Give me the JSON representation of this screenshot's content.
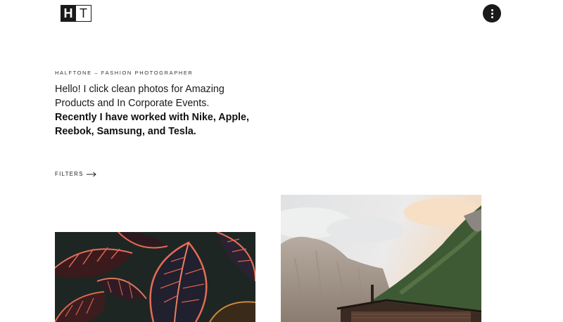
{
  "brand": {
    "logo_letter_1": "H",
    "logo_letter_2": "T"
  },
  "header": {
    "menu_icon": "more-vertical-icon"
  },
  "hero": {
    "eyebrow": "HALFTONE – FASHION PHOTOGRAPHER",
    "intro": "Hello! I click clean photos for Amazing Products and In Corporate Events.",
    "highlight": "Recently I have worked with Nike, Apple, Reebok, Samsung, and Tesla."
  },
  "filters": {
    "label": "FILTERS",
    "icon": "arrow-right-icon"
  },
  "gallery": [
    {
      "subject": "croton-leaves-photo"
    },
    {
      "subject": "mountain-cabin-photo"
    }
  ],
  "colors": {
    "text": "#1a1a1a",
    "background": "#ffffff",
    "accent": "#1a1a1a"
  }
}
